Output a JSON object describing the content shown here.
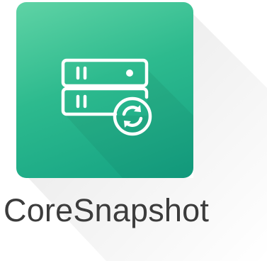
{
  "app": {
    "name": "CoreSnapshot",
    "icon": "server-sync-icon"
  },
  "colors": {
    "tile_top": "#5fd3a5",
    "tile_bottom": "#13a182",
    "icon_stroke": "#ffffff",
    "label_text": "#3c3c3c"
  }
}
